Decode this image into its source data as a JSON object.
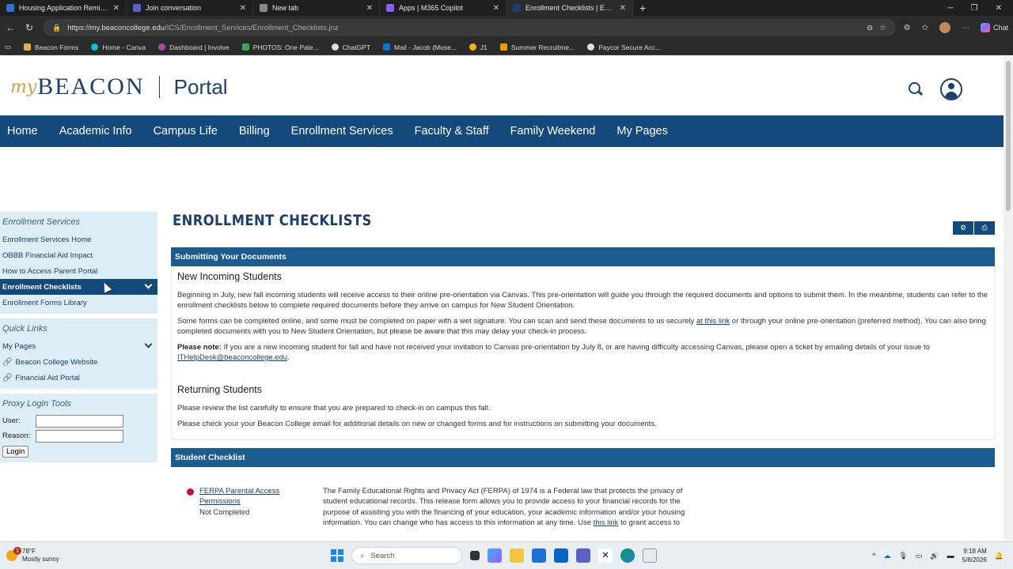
{
  "browser": {
    "tabs": [
      {
        "title": "Housing Application Reminder",
        "color": "#2f6fd6"
      },
      {
        "title": "Join conversation",
        "color": "#5b5fc7"
      },
      {
        "title": "New tab",
        "color": "#888888"
      },
      {
        "title": "Apps | M365 Copilot",
        "color": "#8a5cff"
      },
      {
        "title": "Enrollment Checklists | Enrollment",
        "color": "#1d3f6e"
      }
    ],
    "url_host": "https://my.beaconcollege.edu",
    "url_path": "/ICS/Enrollment_Services/Enrollment_Checklists.jnz",
    "chat_label": "Chat",
    "bookmarks": [
      {
        "label": "Beacon Forms",
        "color": "#e0b040"
      },
      {
        "label": "Home - Canva",
        "color": "#00c4cc"
      },
      {
        "label": "Dashboard | Involve",
        "color": "#a64ca6"
      },
      {
        "label": "PHOTOS: One Pale...",
        "color": "#34a853"
      },
      {
        "label": "ChatGPT",
        "color": "#dddddd"
      },
      {
        "label": "Mail - Jacob (Mose...",
        "color": "#0078d4"
      },
      {
        "label": "J1",
        "color": "#f4b400"
      },
      {
        "label": "Summer Recruitme...",
        "color": "#f29900"
      },
      {
        "label": "Paycor Secure Acc...",
        "color": "#dddddd"
      }
    ]
  },
  "site": {
    "logo_my": "my",
    "logo_beacon": "BEACON",
    "logo_portal": "Portal",
    "nav": [
      "Home",
      "Academic Info",
      "Campus Life",
      "Billing",
      "Enrollment Services",
      "Faculty & Staff",
      "Family Weekend",
      "My Pages"
    ]
  },
  "sidebar": {
    "section_title": "Enrollment Services",
    "items": [
      "Enrollment Services Home",
      "OBBB Financial Aid Impact",
      "How to Access Parent Portal",
      "Enrollment Checklists",
      "Enrollment Forms Library"
    ],
    "quick_links_title": "Quick Links",
    "quick_links": [
      "My Pages",
      "Beacon College Website",
      "Financial Aid Portal"
    ],
    "proxy_title": "Proxy Login Tools",
    "proxy_user_label": "User:",
    "proxy_reason_label": "Reason:",
    "proxy_user_value": "",
    "proxy_reason_value": "",
    "login_label": "Login"
  },
  "content": {
    "title": "ENROLLMENT CHECKLISTS",
    "submitting_header": "Submitting Your Documents",
    "new_students_heading": "New Incoming Students",
    "p1": "Beginning in July, new fall incoming students will receive access to their online pre-orientation via Canvas. This pre-orientation will guide you through the required documents and options to submit them. In the meantime, students can refer to the enrollment checklists below to complete required documents before they arrive on campus for New Student Orientation.",
    "p2_a": "Some forms can be completed online, and some must be completed on paper with a wet signature. You can scan and send these documents to us securely ",
    "p2_link": "at this link",
    "p2_b": " or through your online pre-orientation (preferred method). You can also bring completed documents with you to New Student Orientation, but please be aware that this may delay your check-in process.",
    "p3_bold": "Please note:",
    "p3_text": " If you are a new incoming student for fall and have not received your invitation to Canvas pre-orientation by July 8, or are having difficulty accessing Canvas, please open a ticket by emailing details of your issue to ",
    "p3_link": "ITHelpDesk@beaconcollege.edu",
    "p3_end": ".",
    "returning_heading": "Returning Students",
    "r1": "Please review the list carefully to ensure that you are prepared to check-in on campus this fall.",
    "r2": "Please check your your Beacon College email for additional details on new or changed forms and for instructions on submitting your documents.",
    "checklist_header": "Student Checklist",
    "item_title": "FERPA Parental Access Permissions",
    "item_status": "Not Completed",
    "item_desc_a": "The Family Educational Rights and Privacy Act (FERPA) of 1974 is a Federal law that protects the privacy of student educational records. This release form allows you to provide access to your financial records for the purpose of assisting you with the financing of your education, your academic information and/or your housing information. You can change who has access to this information at any time. Use ",
    "item_desc_link": "this link",
    "item_desc_b": " to grant access to"
  },
  "taskbar": {
    "temp": "78°F",
    "weather": "Mostly sunny",
    "badge": "1",
    "search_placeholder": "Search",
    "time": "9:18 AM",
    "date": "5/8/2026"
  }
}
